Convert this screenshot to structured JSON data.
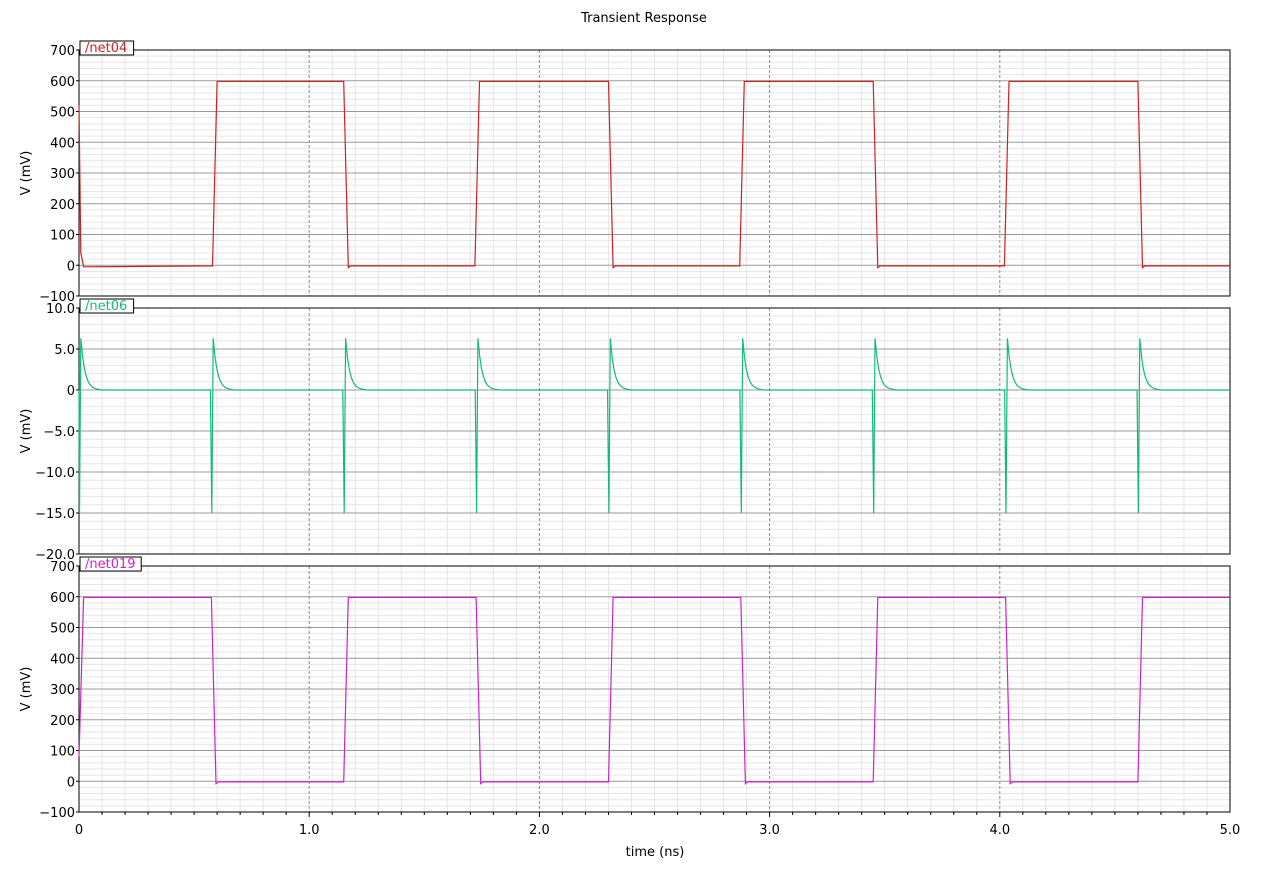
{
  "chart_data": {
    "type": "line",
    "title": "Transient Response",
    "xlabel": "time (ns)",
    "x_ticks": [
      0,
      1.0,
      2.0,
      3.0,
      4.0,
      5.0
    ],
    "x_tick_labels": [
      "0",
      "1.0",
      "2.0",
      "3.0",
      "4.0",
      "5.0"
    ],
    "xlim": [
      0,
      5.0
    ],
    "minor_grid": true,
    "major_grid": true,
    "panels": [
      {
        "name": "/net04",
        "color": "#cc2222",
        "ylabel": "V (mV)",
        "ylim": [
          -100,
          700
        ],
        "y_ticks": [
          -100,
          0,
          100,
          200,
          300,
          400,
          500,
          600,
          700
        ],
        "y_tick_labels": [
          "−100",
          "0",
          "100",
          "200",
          "300",
          "400",
          "500",
          "600",
          "700"
        ],
        "points": [
          [
            0,
            520
          ],
          [
            0.008,
            40
          ],
          [
            0.02,
            -5
          ],
          [
            0.58,
            -2
          ],
          [
            0.6,
            598
          ],
          [
            1.15,
            598
          ],
          [
            1.17,
            -8
          ],
          [
            1.18,
            -2
          ],
          [
            1.72,
            -2
          ],
          [
            1.74,
            598
          ],
          [
            2.3,
            598
          ],
          [
            2.32,
            -8
          ],
          [
            2.33,
            -2
          ],
          [
            2.87,
            -2
          ],
          [
            2.89,
            598
          ],
          [
            3.45,
            598
          ],
          [
            3.47,
            -8
          ],
          [
            3.48,
            -2
          ],
          [
            4.02,
            -2
          ],
          [
            4.04,
            598
          ],
          [
            4.6,
            598
          ],
          [
            4.62,
            -8
          ],
          [
            4.63,
            -2
          ],
          [
            5.0,
            -2
          ]
        ]
      },
      {
        "name": "/net06",
        "color": "#11bb77",
        "ylabel": "V (mV)",
        "ylim": [
          -20,
          10
        ],
        "y_ticks": [
          -20,
          -15,
          -10,
          -5,
          0,
          5,
          10
        ],
        "y_tick_labels": [
          "−20.0",
          "−15.0",
          "−10.0",
          "−5.0",
          "0",
          "5.0",
          "10.0"
        ],
        "spike_times": [
          0.0,
          0.575,
          1.15,
          1.725,
          2.3,
          2.875,
          3.45,
          4.025,
          4.6
        ],
        "spike_min": -15,
        "spike_max": 6.3
      },
      {
        "name": "/net019",
        "color": "#cc22cc",
        "ylabel": "V (mV)",
        "ylim": [
          -100,
          700
        ],
        "y_ticks": [
          -100,
          0,
          100,
          200,
          300,
          400,
          500,
          600,
          700
        ],
        "y_tick_labels": [
          "−100",
          "0",
          "100",
          "200",
          "300",
          "400",
          "500",
          "600",
          "700"
        ],
        "points": [
          [
            0,
            80
          ],
          [
            0.02,
            598
          ],
          [
            0.575,
            598
          ],
          [
            0.595,
            -8
          ],
          [
            0.605,
            -2
          ],
          [
            1.15,
            -2
          ],
          [
            1.17,
            598
          ],
          [
            1.725,
            598
          ],
          [
            1.745,
            -8
          ],
          [
            1.755,
            -2
          ],
          [
            2.3,
            -2
          ],
          [
            2.32,
            598
          ],
          [
            2.875,
            598
          ],
          [
            2.895,
            -8
          ],
          [
            2.905,
            -2
          ],
          [
            3.45,
            -2
          ],
          [
            3.47,
            598
          ],
          [
            4.025,
            598
          ],
          [
            4.045,
            -8
          ],
          [
            4.055,
            -2
          ],
          [
            4.6,
            -2
          ],
          [
            4.62,
            598
          ],
          [
            5.0,
            598
          ]
        ]
      }
    ]
  }
}
